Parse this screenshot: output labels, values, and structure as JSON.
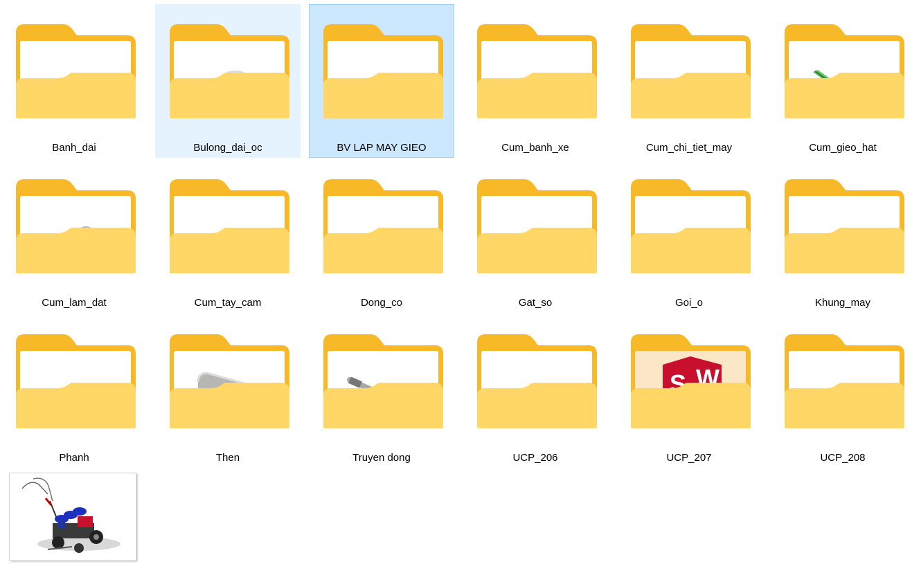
{
  "items": [
    {
      "label": "Banh_dai",
      "thumb": "pulley-icon"
    },
    {
      "label": "Bulong_dai_oc",
      "thumb": "hex-bolt-icon"
    },
    {
      "label": "BV LAP MAY GIEO",
      "thumb": "assembly-icon"
    },
    {
      "label": "Cum_banh_xe",
      "thumb": "wheel-icon"
    },
    {
      "label": "Cum_chi_tiet_may",
      "thumb": "chain-part-icon"
    },
    {
      "label": "Cum_gieo_hat",
      "thumb": "green-bar-icon"
    },
    {
      "label": "Cum_lam_dat",
      "thumb": "bracket-icon"
    },
    {
      "label": "Cum_tay_cam",
      "thumb": "black-part-icon"
    },
    {
      "label": "Dong_co",
      "thumb": "engine-icon"
    },
    {
      "label": "Gat_so",
      "thumb": "lever-icon"
    },
    {
      "label": "Goi_o",
      "thumb": "bearing-block-icon"
    },
    {
      "label": "Khung_may",
      "thumb": "plate-icon"
    },
    {
      "label": "Phanh",
      "thumb": "brake-icon"
    },
    {
      "label": "Then",
      "thumb": "key-part-icon"
    },
    {
      "label": "Truyen dong",
      "thumb": "shaft-icon"
    },
    {
      "label": "UCP_206",
      "thumb": "ring-icon"
    },
    {
      "label": "UCP_207",
      "thumb": "solidworks-icon"
    },
    {
      "label": "UCP_208",
      "thumb": "cylinder-icon"
    }
  ],
  "selected_label": "BV LAP MAY GIEO",
  "hover_label": "Bulong_dai_oc",
  "preview": {
    "thumb": "seeder-machine-preview"
  },
  "colors": {
    "folder_back": "#f7b928",
    "folder_front": "#ffd766",
    "selection": "#cce8ff",
    "selection_border": "#99d1ff",
    "hover": "#e5f3ff"
  }
}
